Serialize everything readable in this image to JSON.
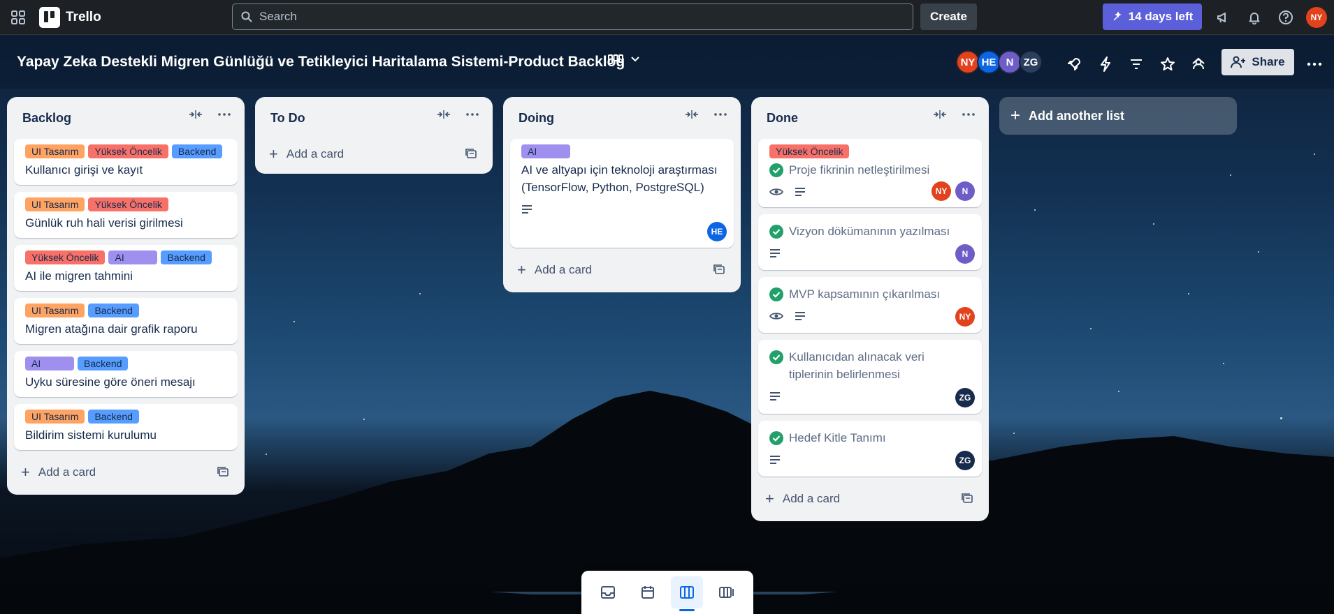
{
  "topbar": {
    "app_name": "Trello",
    "search_placeholder": "Search",
    "create_label": "Create",
    "trial_label": "14 days left",
    "user_initials": "NY"
  },
  "board": {
    "title": "Yapay Zeka Destekli Migren Günlüğü ve Tetikleyici Haritalama Sistemi-Product Backlog",
    "members": [
      "NY",
      "HE",
      "N",
      "ZG"
    ],
    "share_label": "Share"
  },
  "colors": {
    "label_ui": "#fea362",
    "label_high": "#f87168",
    "label_backend": "#579dff",
    "label_ai": "#9f8fef",
    "avatar_ny": "#e2421c",
    "avatar_he": "#0c66e4",
    "avatar_n": "#6e5dc6",
    "avatar_zg": "#172b4d"
  },
  "lists": {
    "backlog": {
      "title": "Backlog",
      "add_card": "Add a card",
      "cards": [
        {
          "labels": [
            "UI Tasarım",
            "Yüksek Öncelik",
            "Backend"
          ],
          "title": "Kullanıcı girişi ve kayıt"
        },
        {
          "labels": [
            "UI Tasarım",
            "Yüksek Öncelik"
          ],
          "title": "Günlük ruh hali verisi girilmesi"
        },
        {
          "labels": [
            "Yüksek Öncelik",
            "AI",
            "Backend"
          ],
          "title": "AI ile migren tahmini"
        },
        {
          "labels": [
            "UI Tasarım",
            "Backend"
          ],
          "title": "Migren atağına dair grafik raporu"
        },
        {
          "labels": [
            "AI",
            "Backend"
          ],
          "title": "Uyku süresine göre öneri mesajı"
        },
        {
          "labels": [
            "UI Tasarım",
            "Backend"
          ],
          "title": "Bildirim sistemi kurulumu"
        }
      ]
    },
    "todo": {
      "title": "To Do",
      "add_card": "Add a card"
    },
    "doing": {
      "title": "Doing",
      "add_card": "Add a card",
      "cards": [
        {
          "labels": [
            "AI"
          ],
          "title": "AI ve altyapı için teknoloji araştırması (TensorFlow, Python, PostgreSQL)",
          "members": [
            "HE"
          ]
        }
      ]
    },
    "done": {
      "title": "Done",
      "add_card": "Add a card",
      "cards": [
        {
          "labels": [
            "Yüksek Öncelik"
          ],
          "title": "Proje fikrinin netleştirilmesi",
          "members": [
            "NY",
            "N"
          ]
        },
        {
          "title": "Vizyon dökümanının yazılması",
          "members": [
            "N"
          ]
        },
        {
          "title": "MVP kapsamının çıkarılması",
          "members": [
            "NY"
          ]
        },
        {
          "title": "Kullanıcıdan alınacak veri tiplerinin belirlenmesi",
          "members": [
            "ZG"
          ]
        },
        {
          "title": "Hedef Kitle Tanımı",
          "members": [
            "ZG"
          ]
        }
      ]
    }
  },
  "add_list_label": "Add another list"
}
